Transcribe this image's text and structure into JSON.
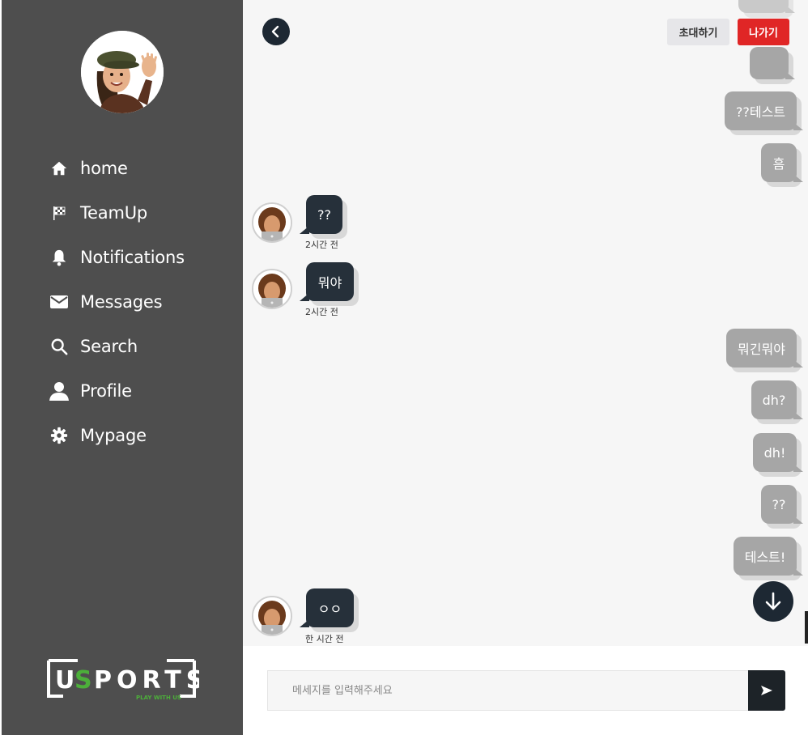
{
  "sidebar": {
    "nav": [
      {
        "label": "home",
        "icon": "home-icon"
      },
      {
        "label": "TeamUp",
        "icon": "checkered-flag-icon"
      },
      {
        "label": "Notifications",
        "icon": "bell-icon"
      },
      {
        "label": "Messages",
        "icon": "envelope-icon"
      },
      {
        "label": "Search",
        "icon": "search-icon"
      },
      {
        "label": "Profile",
        "icon": "user-icon"
      },
      {
        "label": "Mypage",
        "icon": "gear-icon"
      }
    ],
    "logo": {
      "word": "USPORTS",
      "tagline": "PLAY WITH US"
    }
  },
  "header": {
    "invite_label": "초대하기",
    "exit_label": "나가기"
  },
  "messages": [
    {
      "sender": "me",
      "text": "??테스트"
    },
    {
      "sender": "me",
      "text": "흠"
    },
    {
      "sender": "other",
      "text": "??",
      "time": "2시간 전"
    },
    {
      "sender": "other",
      "text": "뭐야",
      "time": "2시간 전"
    },
    {
      "sender": "me",
      "text": "뭐긴뭐야"
    },
    {
      "sender": "me",
      "text": "dh?"
    },
    {
      "sender": "me",
      "text": "dh!"
    },
    {
      "sender": "me",
      "text": "??"
    },
    {
      "sender": "me",
      "text": "테스트!"
    },
    {
      "sender": "other",
      "text": "ㅇㅇ",
      "time": "한 시간 전"
    }
  ],
  "composer": {
    "placeholder": "메세지를 입력해주세요"
  },
  "colors": {
    "sidebar_bg": "#4e4e4e",
    "chat_bg": "#f6f6f6",
    "my_bubble": "#a6a6a6",
    "other_bubble": "#26303a",
    "exit_red": "#e02626",
    "logo_green": "#4caf3a"
  }
}
